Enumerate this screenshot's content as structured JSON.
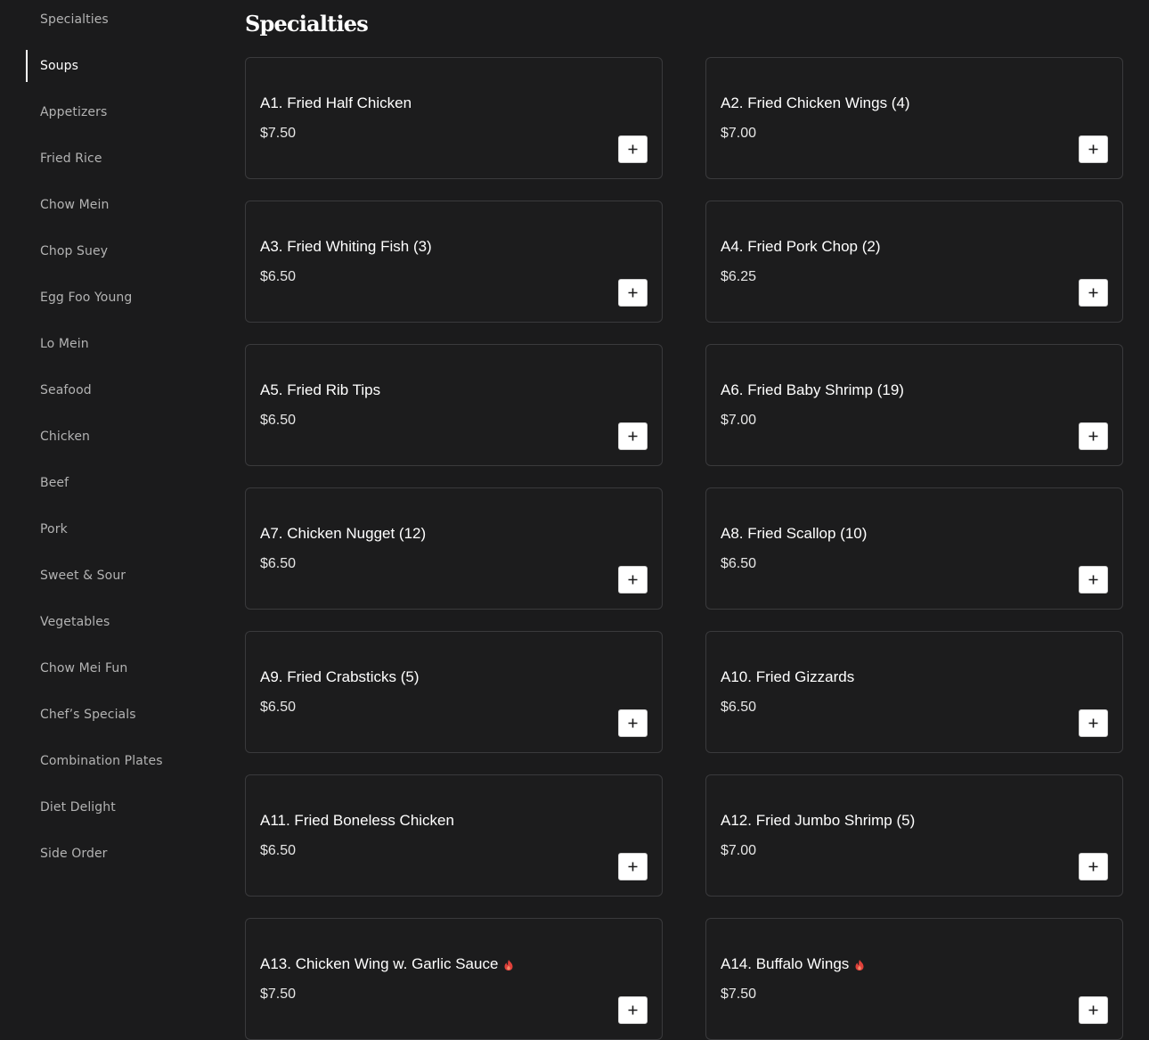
{
  "sidebar": {
    "items": [
      {
        "label": "Specialties",
        "active": false
      },
      {
        "label": "Soups",
        "active": true
      },
      {
        "label": "Appetizers",
        "active": false
      },
      {
        "label": "Fried Rice",
        "active": false
      },
      {
        "label": "Chow Mein",
        "active": false
      },
      {
        "label": "Chop Suey",
        "active": false
      },
      {
        "label": "Egg Foo Young",
        "active": false
      },
      {
        "label": "Lo Mein",
        "active": false
      },
      {
        "label": "Seafood",
        "active": false
      },
      {
        "label": "Chicken",
        "active": false
      },
      {
        "label": "Beef",
        "active": false
      },
      {
        "label": "Pork",
        "active": false
      },
      {
        "label": "Sweet & Sour",
        "active": false
      },
      {
        "label": "Vegetables",
        "active": false
      },
      {
        "label": "Chow Mei Fun",
        "active": false
      },
      {
        "label": "Chef’s Specials",
        "active": false
      },
      {
        "label": "Combination Plates",
        "active": false
      },
      {
        "label": "Diet Delight",
        "active": false
      },
      {
        "label": "Side Order",
        "active": false
      }
    ]
  },
  "section": {
    "title": "Specialties"
  },
  "items": [
    {
      "name": "A1. Fried Half Chicken",
      "price": "$7.50",
      "spicy": false
    },
    {
      "name": "A2. Fried Chicken Wings (4)",
      "price": "$7.00",
      "spicy": false
    },
    {
      "name": "A3. Fried Whiting Fish (3)",
      "price": "$6.50",
      "spicy": false
    },
    {
      "name": "A4. Fried Pork Chop (2)",
      "price": "$6.25",
      "spicy": false
    },
    {
      "name": "A5. Fried Rib Tips",
      "price": "$6.50",
      "spicy": false
    },
    {
      "name": "A6. Fried Baby Shrimp (19)",
      "price": "$7.00",
      "spicy": false
    },
    {
      "name": "A7. Chicken Nugget (12)",
      "price": "$6.50",
      "spicy": false
    },
    {
      "name": "A8. Fried Scallop (10)",
      "price": "$6.50",
      "spicy": false
    },
    {
      "name": "A9. Fried Crabsticks (5)",
      "price": "$6.50",
      "spicy": false
    },
    {
      "name": "A10. Fried Gizzards",
      "price": "$6.50",
      "spicy": false
    },
    {
      "name": "A11. Fried Boneless Chicken",
      "price": "$6.50",
      "spicy": false
    },
    {
      "name": "A12. Fried Jumbo Shrimp (5)",
      "price": "$7.00",
      "spicy": false
    },
    {
      "name": "A13. Chicken Wing w. Garlic Sauce",
      "price": "$7.50",
      "spicy": true
    },
    {
      "name": "A14. Buffalo Wings",
      "price": "$7.50",
      "spicy": true
    }
  ],
  "icons": {
    "add": "plus-icon",
    "spicy": "chili-flame-icon"
  },
  "colors": {
    "background": "#1b1b1c",
    "card_border": "#3a3a3c",
    "spicy": "#e0403a",
    "sidebar_text": "#b3b3b3"
  }
}
